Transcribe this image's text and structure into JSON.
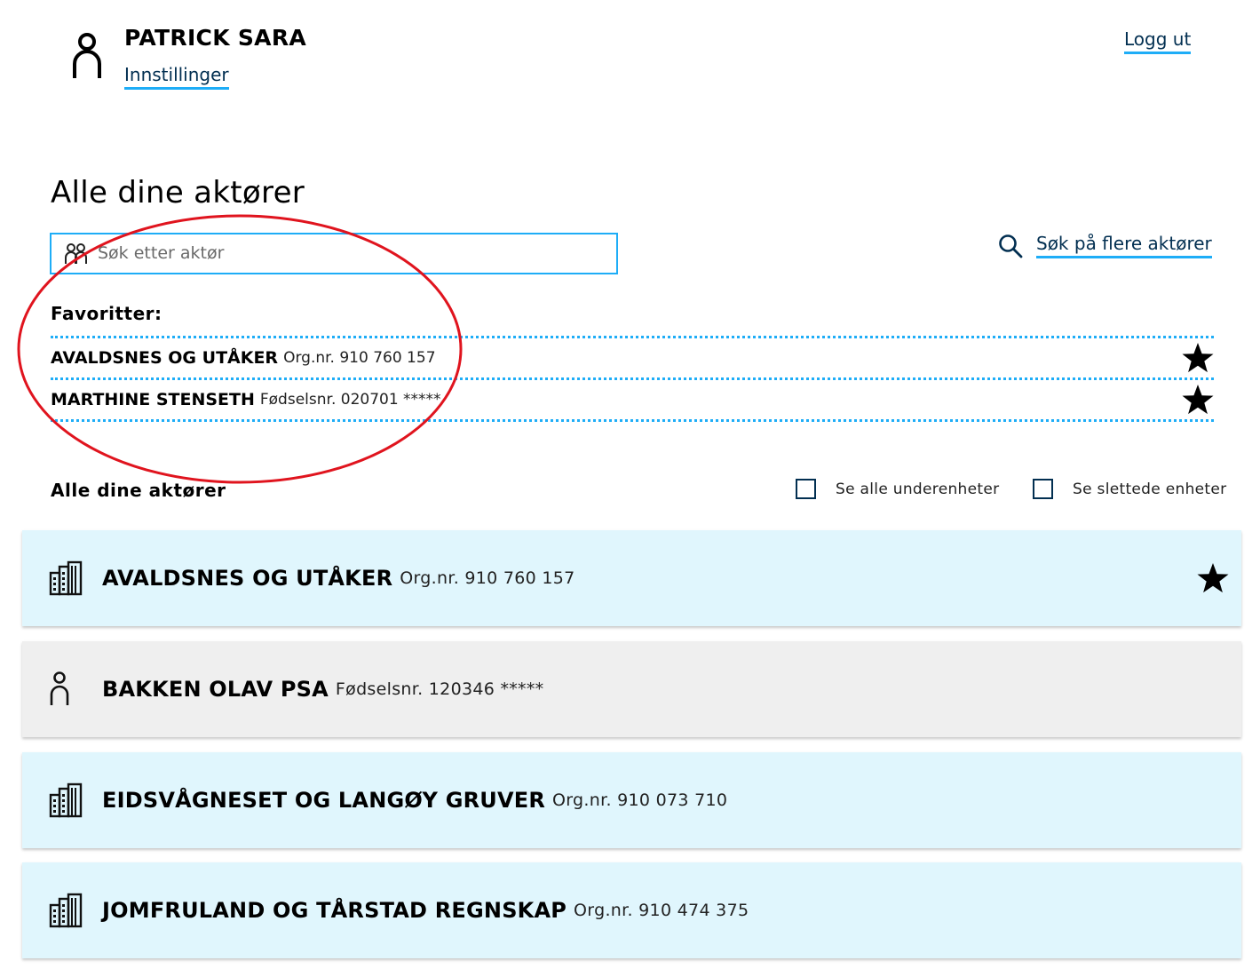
{
  "header": {
    "user_name": "PATRICK SARA",
    "settings_label": "Innstillinger",
    "logout_label": "Logg ut"
  },
  "page_title": "Alle dine aktører",
  "search": {
    "placeholder": "Søk etter aktør",
    "value": "",
    "more_label": "Søk på flere aktører"
  },
  "favorites": {
    "heading": "Favoritter:",
    "items": [
      {
        "name": "AVALDSNES OG UTÅKER",
        "id_text": "Org.nr. 910 760 157",
        "icon": "star-filled-icon"
      },
      {
        "name": "MARTHINE STENSETH",
        "id_text": "Fødselsnr. 020701 *****",
        "icon": "star-filled-icon"
      }
    ]
  },
  "all_actors": {
    "heading": "Alle dine aktører",
    "filters": [
      {
        "label": "Se alle underenheter",
        "checked": false
      },
      {
        "label": "Se slettede enheter",
        "checked": false
      }
    ],
    "items": [
      {
        "type": "organization",
        "icon": "building-icon",
        "name": "AVALDSNES OG UTÅKER",
        "id_text": "Org.nr. 910 760 157",
        "favorite": true
      },
      {
        "type": "person",
        "icon": "person-icon",
        "name": "BAKKEN OLAV PSA",
        "id_text": "Fødselsnr. 120346 *****",
        "favorite": false
      },
      {
        "type": "organization",
        "icon": "building-icon",
        "name": "EIDSVÅGNESET OG LANGØY GRUVER",
        "id_text": "Org.nr. 910 073 710",
        "favorite": false
      },
      {
        "type": "organization",
        "icon": "building-icon",
        "name": "JOMFRULAND OG TÅRSTAD REGNSKAP",
        "id_text": "Org.nr. 910 474 375",
        "favorite": false
      }
    ]
  },
  "colors": {
    "accent": "#1eadf7",
    "link_text": "#022f51",
    "org_card_bg": "#e0f6fd",
    "person_card_bg": "#efefef",
    "annotation": "#e0141e"
  }
}
